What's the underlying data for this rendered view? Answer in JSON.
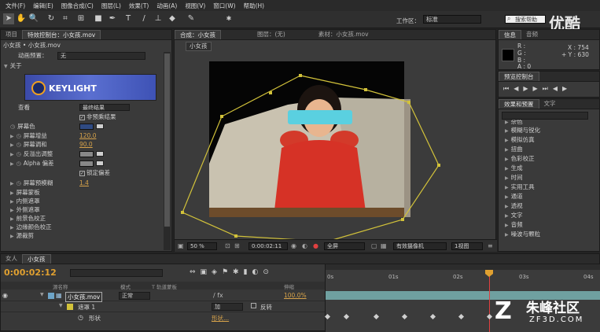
{
  "menu": [
    "文件(F)",
    "编辑(E)",
    "图像合成(C)",
    "图层(L)",
    "效果(T)",
    "动画(A)",
    "视图(V)",
    "窗口(W)",
    "帮助(H)"
  ],
  "toolbar": {
    "workspace_label": "工作区：",
    "workspace_value": "标准",
    "search_placeholder": "搜索帮助"
  },
  "watermark_top": "优酷",
  "project_panel": {
    "tabs": [
      "项目",
      "特效控制台：小女孩.mov"
    ],
    "breadcrumb": "小女孩 • 小女孩.mov",
    "preset_label": "动画预置：",
    "preset_value": "无",
    "fx_name": "关于",
    "logo_text": "KEYLIGHT"
  },
  "keylight": {
    "view_label": "查看",
    "view_value": "最终结果",
    "unpremult_label": "非预乘结果",
    "rows": [
      {
        "label": "屏幕色",
        "value": "",
        "kind": "color"
      },
      {
        "label": "屏幕增益",
        "value": "120.0",
        "kind": "num"
      },
      {
        "label": "屏幕调和",
        "value": "90.0",
        "kind": "num"
      },
      {
        "label": "反溢出调整",
        "value": "",
        "kind": "bar"
      },
      {
        "label": "Alpha 偏差",
        "value": "",
        "kind": "bar"
      },
      {
        "label": "锁定偏差",
        "value": "",
        "kind": "check"
      },
      {
        "label": "屏幕预模糊",
        "value": "1.4",
        "kind": "num"
      },
      {
        "label": "屏幕蒙板",
        "value": "",
        "kind": "group"
      },
      {
        "label": "内侧遮罩",
        "value": "",
        "kind": "group"
      },
      {
        "label": "外侧遮罩",
        "value": "",
        "kind": "group"
      },
      {
        "label": "前景色校正",
        "value": "",
        "kind": "group"
      },
      {
        "label": "边缘颜色校正",
        "value": "",
        "kind": "group"
      },
      {
        "label": "源裁剪",
        "value": "",
        "kind": "group"
      }
    ],
    "screen_color": "#2f4a82"
  },
  "comp_panel": {
    "tabs": [
      "合成：小女孩",
      "图层：(无)",
      "素材：小女孩.mov"
    ],
    "comp_tab": "小女孩",
    "zoom": "50 %",
    "timecode": "0:00:02:11",
    "resolution": "全屏",
    "camera": "有效摄像机",
    "views": "1视图"
  },
  "info_panel": {
    "tabs": [
      "信息",
      "音频"
    ],
    "r": "R :",
    "g": "G :",
    "b": "B :",
    "a": "A : 0",
    "x": "X : 754",
    "y": "+ Y : 630"
  },
  "preview_panel": {
    "tab": "预览控制台"
  },
  "effects_panel": {
    "tabs": [
      "效果和预置",
      "文字"
    ],
    "items": [
      "杂色",
      "模糊与锐化",
      "模拟仿真",
      "扭曲",
      "色彩校正",
      "生成",
      "时间",
      "实用工具",
      "通道",
      "透视",
      "文字",
      "音频",
      "噪波与颗粒"
    ]
  },
  "timeline": {
    "tabs": [
      "女人",
      "小女孩"
    ],
    "timecode": "0:00:02:12",
    "headers": {
      "source": "源名称",
      "mode": "模式",
      "trkmat": "T 轨道蒙板",
      "parent": "伸缩"
    },
    "layer_name": "小女孩.mov",
    "layer_mode": "正常",
    "layer_stretch": "100.0%",
    "mask_name": "遮罩 1",
    "mask_mode": "加",
    "mask_inverted": "反转",
    "mask_prop": "形状",
    "mask_val": "形状...",
    "ruler": [
      "0s",
      "01s",
      "02s",
      "03s",
      "04s"
    ]
  },
  "watermark_bottom": {
    "text": "朱峰社区",
    "url": "ZF3D.COM"
  },
  "colors": {
    "accent": "#d6a24a",
    "panel": "#3a3a3a",
    "bg": "#232323",
    "mask_line": "#d2c23a"
  }
}
